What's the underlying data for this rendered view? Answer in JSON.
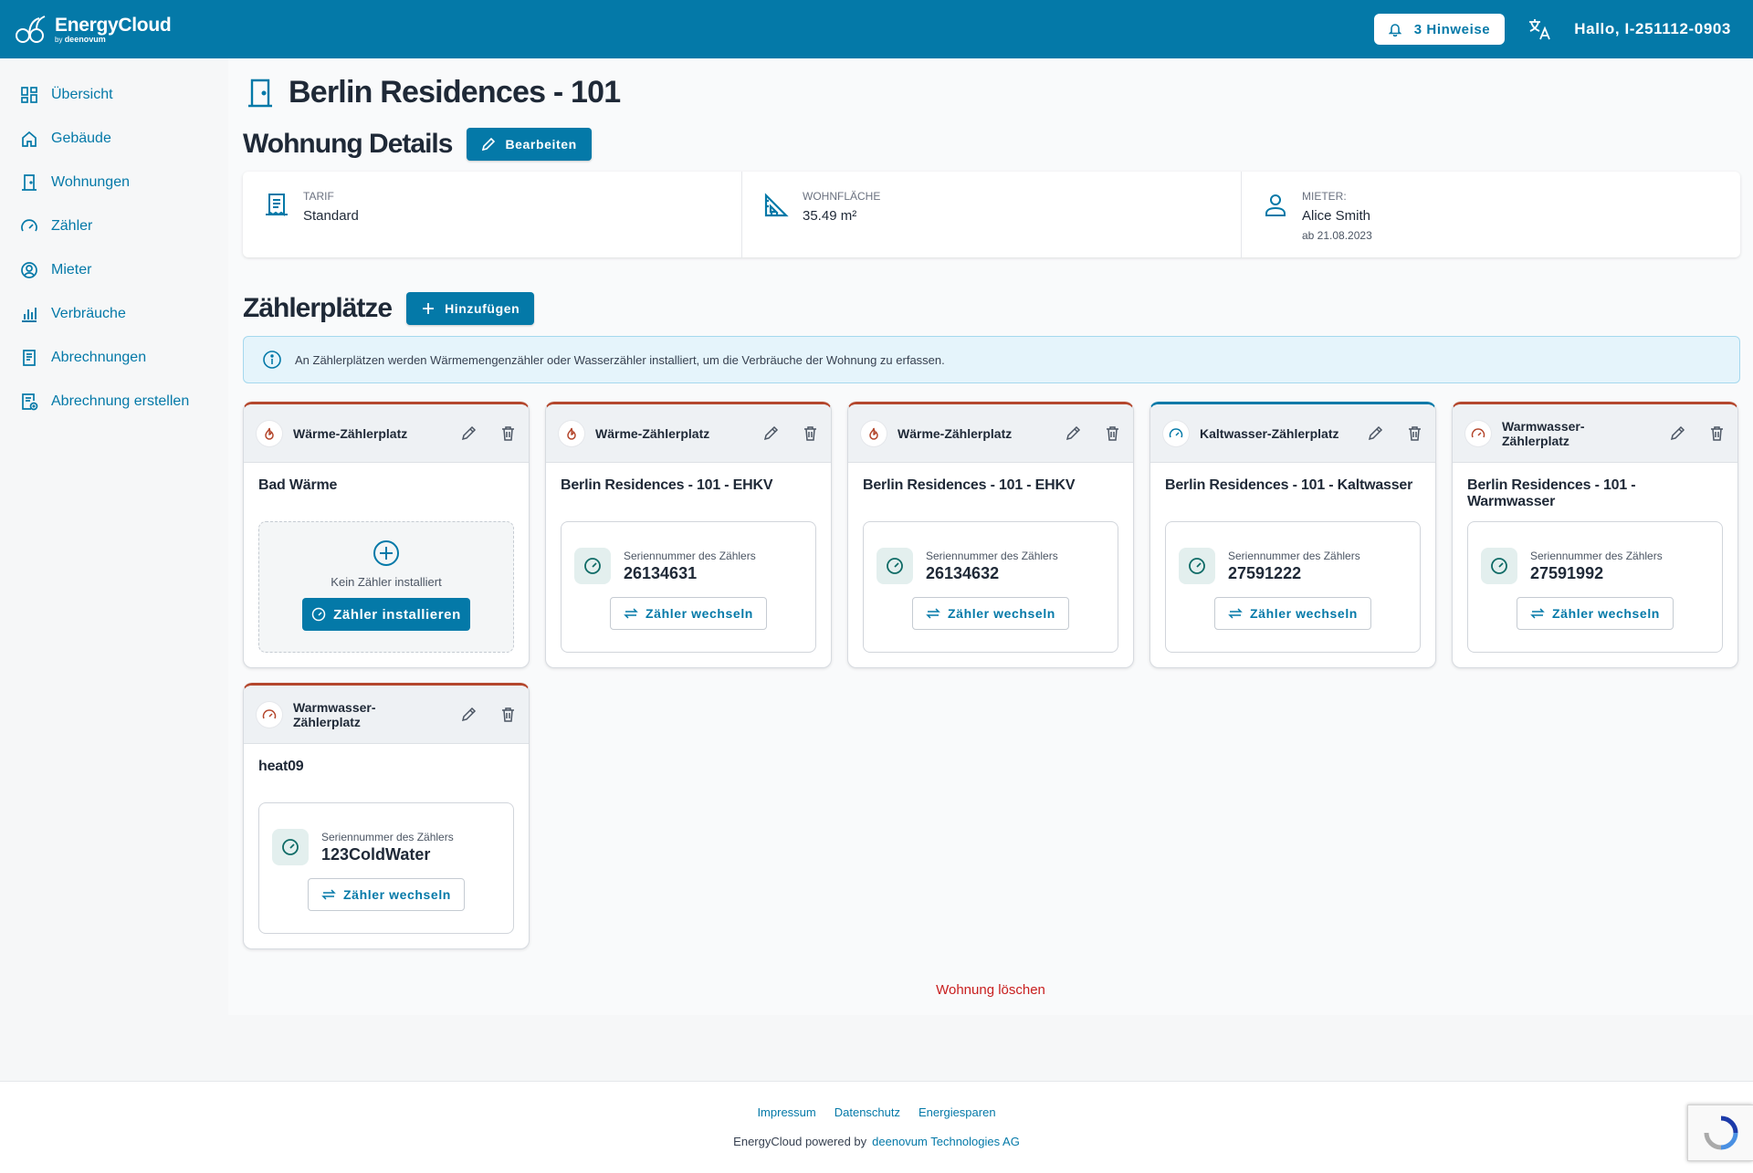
{
  "header": {
    "brand_name": "EnergyCloud",
    "brand_sub_prefix": "by",
    "brand_sub_company": "deenovum",
    "notifications_label": "3 Hinweise",
    "greeting": "Hallo, I-251112-0903"
  },
  "sidebar": {
    "items": [
      {
        "label": "Übersicht",
        "icon": "dashboard-icon"
      },
      {
        "label": "Gebäude",
        "icon": "home-icon"
      },
      {
        "label": "Wohnungen",
        "icon": "door-icon"
      },
      {
        "label": "Zähler",
        "icon": "gauge-icon"
      },
      {
        "label": "Mieter",
        "icon": "user-circle-icon"
      },
      {
        "label": "Verbräuche",
        "icon": "bar-chart-icon"
      },
      {
        "label": "Abrechnungen",
        "icon": "receipt-icon"
      },
      {
        "label": "Abrechnung erstellen",
        "icon": "receipt-add-icon"
      }
    ]
  },
  "page": {
    "title": "Berlin Residences - 101",
    "details_title": "Wohnung Details",
    "edit_label": "Bearbeiten",
    "details": [
      {
        "label": "Tarif",
        "value": "Standard",
        "extra": "",
        "icon": "document-icon"
      },
      {
        "label": "Wohnfläche",
        "value": "35.49 m²",
        "extra": "",
        "icon": "ruler-triangle-icon"
      },
      {
        "label": "Mieter:",
        "value": "Alice Smith",
        "extra": "ab 21.08.2023",
        "icon": "person-icon"
      }
    ],
    "slots_title": "Zählerplätze",
    "add_label": "Hinzufügen",
    "info_text": "An Zählerplätzen werden Wärmemengenzähler oder Wasserzähler installiert, um die Verbräuche der Wohnung zu erfassen.",
    "serial_label": "Seriennummer des Zählers",
    "change_label": "Zähler wechseln",
    "empty_label": "Kein Zähler installiert",
    "install_label": "Zähler installieren",
    "delete_label": "Wohnung löschen"
  },
  "slots": [
    {
      "type": "Wärme-Zählerplatz",
      "kind": "heat",
      "name": "Bad Wärme",
      "serial": ""
    },
    {
      "type": "Wärme-Zählerplatz",
      "kind": "heat",
      "name": "Berlin Residences - 101 - EHKV",
      "serial": "26134631"
    },
    {
      "type": "Wärme-Zählerplatz",
      "kind": "heat",
      "name": "Berlin Residences - 101 - EHKV",
      "serial": "26134632"
    },
    {
      "type": "Kaltwasser-Zählerplatz",
      "kind": "cold",
      "name": "Berlin Residences - 101 - Kaltwasser",
      "serial": "27591222"
    },
    {
      "type": "Warmwasser-Zählerplatz",
      "kind": "warm",
      "name": "Berlin Residences - 101 - Warmwasser",
      "serial": "27591992"
    },
    {
      "type": "Warmwasser-Zählerplatz",
      "kind": "warm",
      "name": "heat09",
      "serial": "123ColdWater"
    }
  ],
  "footer": {
    "links": [
      "Impressum",
      "Datenschutz",
      "Energiesparen"
    ],
    "credit_prefix": "EnergyCloud powered by",
    "credit_company": "deenovum Technologies AG"
  },
  "colors": {
    "primary": "#0479a8",
    "heat_accent": "#b4472d",
    "danger": "#c81e1e"
  }
}
